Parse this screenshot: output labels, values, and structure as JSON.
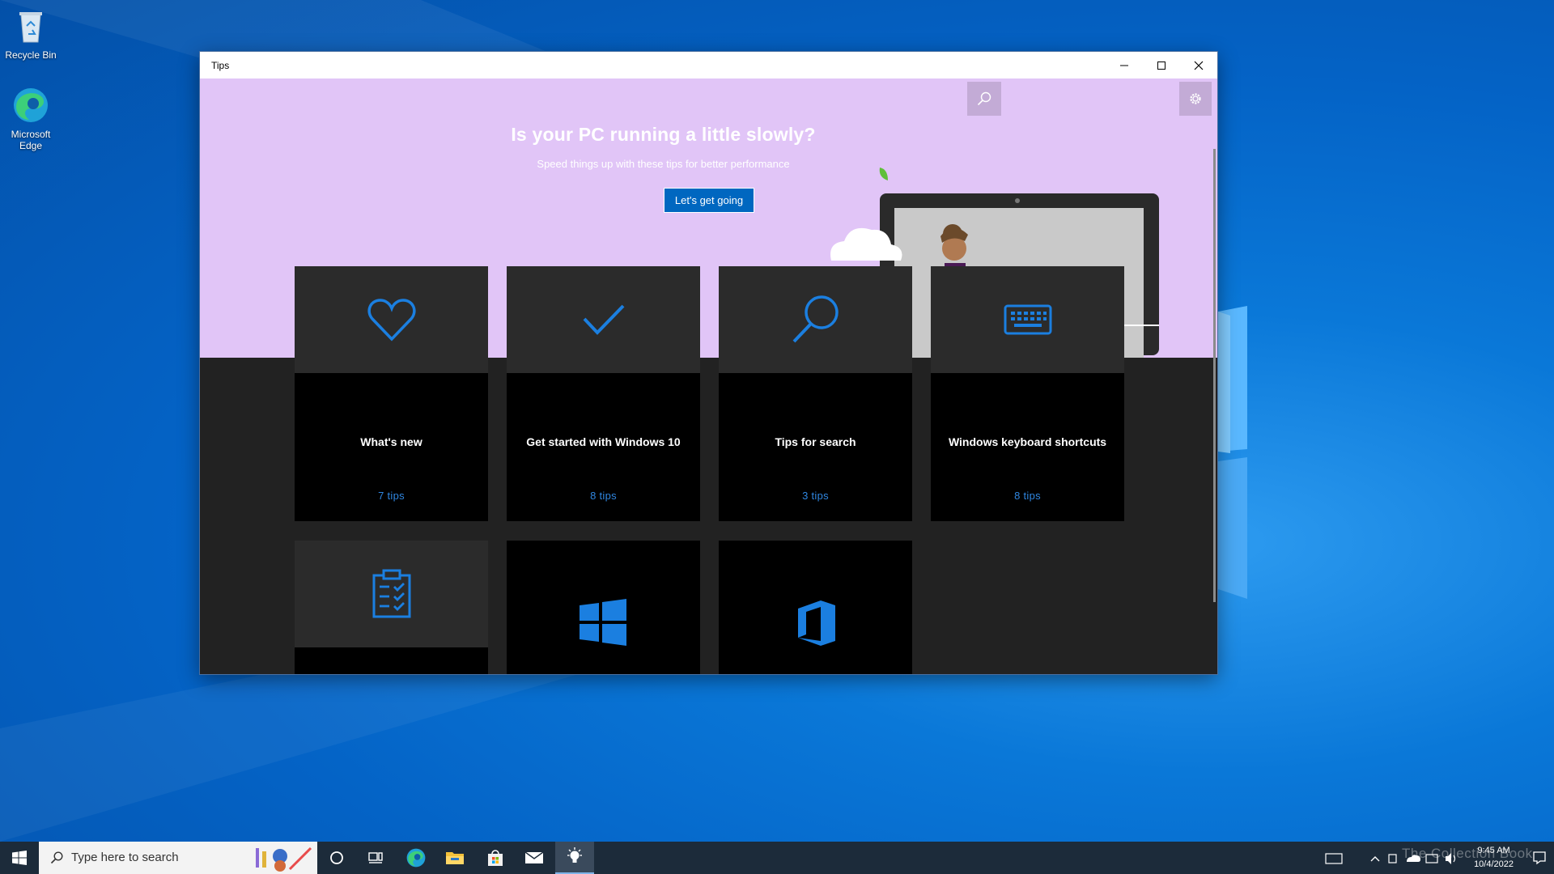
{
  "desktop": {
    "icons": [
      {
        "label": "Recycle Bin",
        "icon": "recycle-bin-icon"
      },
      {
        "label": "Microsoft Edge",
        "icon": "edge-icon"
      }
    ]
  },
  "window": {
    "title": "Tips",
    "controls": [
      "minimize-icon",
      "maximize-icon",
      "close-icon"
    ],
    "toolbar": [
      "search-icon",
      "gear-icon"
    ]
  },
  "hero": {
    "title": "Is your PC running a little slowly?",
    "subtitle": "Speed things up with these tips for better performance",
    "button_label": "Let's get going",
    "background": "#e1c5f7"
  },
  "collections": [
    {
      "name": "What's new",
      "count": "7 tips",
      "icon": "heart-icon"
    },
    {
      "name": "Get started with Windows 10",
      "count": "8 tips",
      "icon": "checkmark-icon"
    },
    {
      "name": "Tips for search",
      "count": "3 tips",
      "icon": "search-icon"
    },
    {
      "name": "Windows keyboard shortcuts",
      "count": "8 tips",
      "icon": "keyboard-icon"
    },
    {
      "name": "",
      "count": "",
      "icon": "clipboard-checklist-icon"
    },
    {
      "name": "",
      "count": "",
      "icon": "windows-logo-icon"
    },
    {
      "name": "",
      "count": "",
      "icon": "office-logo-icon"
    }
  ],
  "taskbar": {
    "search_placeholder": "Type here to search",
    "apps": [
      "cortana-icon",
      "task-view-icon",
      "edge-icon",
      "file-explorer-icon",
      "store-icon",
      "mail-icon",
      "tips-icon"
    ],
    "time": "9:45 AM",
    "date": "10/4/2022",
    "watermark": "The Collection Book"
  },
  "colors": {
    "accent": "#0078d7",
    "tile_icon": "#1b7fe0",
    "tip_count": "#2f86e0",
    "tile_bg": "#2b2b2b",
    "taskbar": "#1c2b3a"
  }
}
